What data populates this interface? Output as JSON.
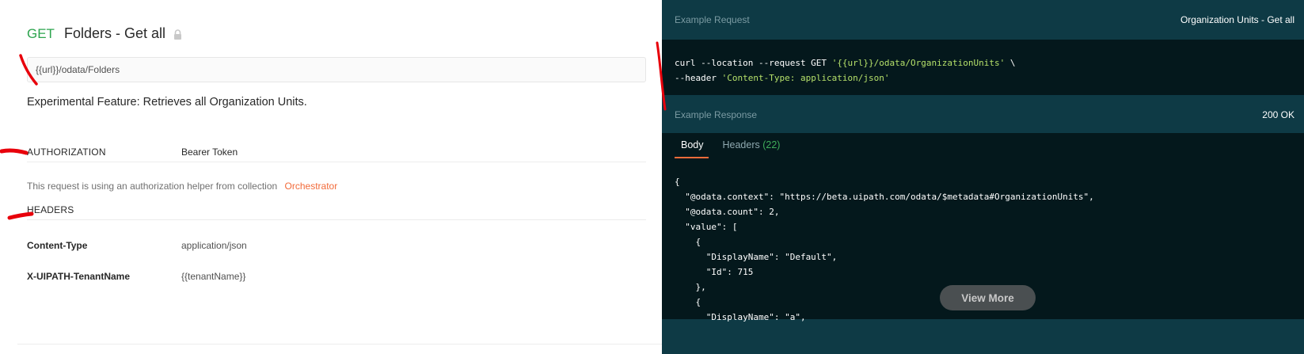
{
  "request": {
    "method": "GET",
    "title": "Folders - Get all",
    "url": "{{url}}/odata/Folders",
    "description": "Experimental Feature: Retrieves all Organization Units."
  },
  "authorization": {
    "label": "AUTHORIZATION",
    "value": "Bearer Token",
    "helper_text": "This request is using an authorization helper from collection",
    "helper_link": "Orchestrator"
  },
  "headers_section": {
    "label": "HEADERS",
    "items": [
      {
        "key": "Content-Type",
        "value": "application/json"
      },
      {
        "key": "X-UIPATH-TenantName",
        "value": "{{tenantName}}"
      }
    ]
  },
  "example_request": {
    "label": "Example Request",
    "name": "Organization Units - Get all",
    "code_line1_prefix": "curl --location --request GET ",
    "code_line1_string": "'{{url}}/odata/OrganizationUnits'",
    "code_line1_suffix": " \\",
    "code_line2_prefix": "--header ",
    "code_line2_string": "'Content-Type: application/json'"
  },
  "example_response": {
    "label": "Example Response",
    "status": "200 OK",
    "tab_body": "Body",
    "tab_headers": "Headers",
    "headers_count": "(22)",
    "json_lines": [
      "{",
      "  \"@odata.context\": \"https://beta.uipath.com/odata/$metadata#OrganizationUnits\",",
      "  \"@odata.count\": 2,",
      "  \"value\": [",
      "    {",
      "      \"DisplayName\": \"Default\",",
      "      \"Id\": 715",
      "    },",
      "    {",
      "      \"DisplayName\": \"a\","
    ],
    "view_more": "View More"
  },
  "icons": {
    "lock": "lock-icon"
  },
  "colors": {
    "method_get": "#2da44e",
    "link": "#f26b3a",
    "panel": "#0e3a45",
    "code_bg": "#04181c",
    "annotation": "#e8000b"
  }
}
